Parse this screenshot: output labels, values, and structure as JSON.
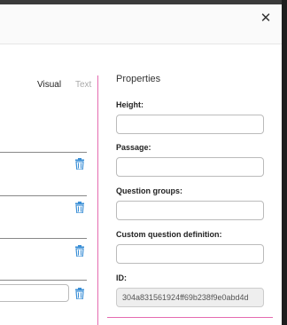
{
  "modal": {
    "close_label": "✕"
  },
  "tabs": {
    "visual": "Visual",
    "text": "Text"
  },
  "properties": {
    "title": "Properties",
    "fields": [
      {
        "label": "Height:",
        "value": ""
      },
      {
        "label": "Passage:",
        "value": ""
      },
      {
        "label": "Question groups:",
        "value": ""
      },
      {
        "label": "Custom question definition:",
        "value": ""
      },
      {
        "label": "ID:",
        "value": "304a831561924ff69b238f9e0abd4d"
      }
    ]
  },
  "colors": {
    "accent": "#e56bb0",
    "trash_icon": "#3b8fd6"
  },
  "icons": {
    "trash": "trash-icon",
    "close": "close-icon"
  }
}
